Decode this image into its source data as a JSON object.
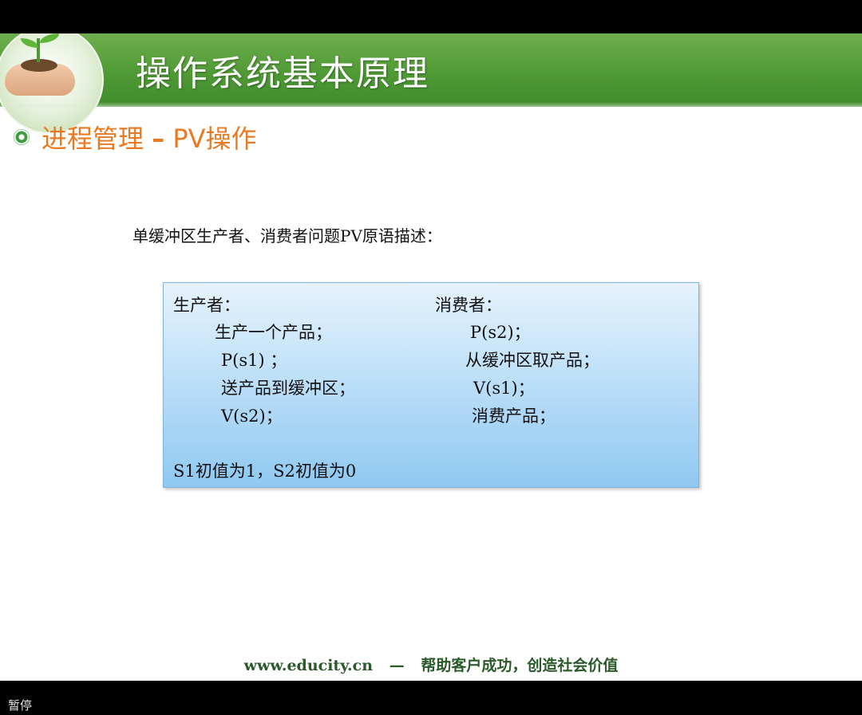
{
  "slide": {
    "title": "操作系统基本原理",
    "section_prefix": "进程管理",
    "section_dash": "–",
    "section_suffix": "PV操作",
    "description": "单缓冲区生产者、消费者问题PV原语描述："
  },
  "code_box": {
    "producer_header": "生产者：",
    "producer_lines": [
      "生产一个产品；",
      "P(s1) ；",
      "送产品到缓冲区；",
      "V(s2)；"
    ],
    "consumer_header": "消费者：",
    "consumer_lines": [
      "P(s2)；",
      "从缓冲区取产品；",
      "V(s1)；",
      "消费产品；"
    ],
    "init_note": "S1初值为1，S2初值为0"
  },
  "footer": {
    "url": "www.educity.cn",
    "dash": "—",
    "slogan": "帮助客户成功，创造社会价值"
  },
  "player": {
    "status": "暂停"
  },
  "colors": {
    "header_green": "#4f9a35",
    "section_orange": "#ea7a22",
    "box_blue": "#8fc8f1"
  },
  "icons": {
    "bullet": "flower-bullet-icon",
    "logo": "sprout-in-hands-logo"
  }
}
